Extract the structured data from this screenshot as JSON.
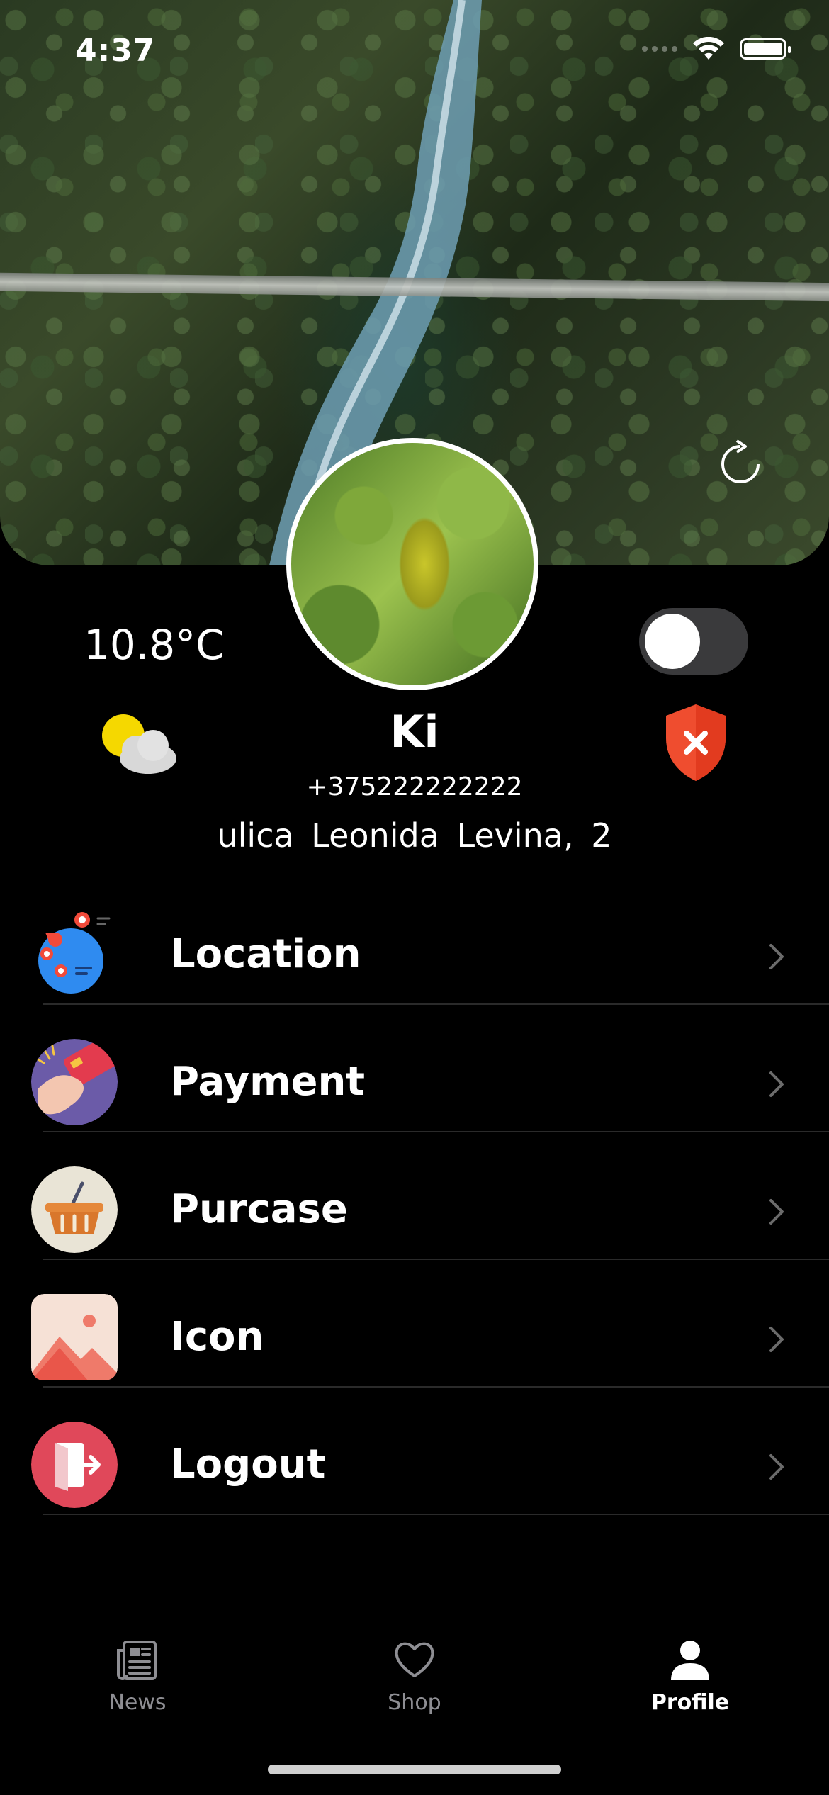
{
  "status_bar": {
    "time": "4:37"
  },
  "profile": {
    "temperature": "10.8°C",
    "name": "Ki",
    "phone": "+375222222222",
    "address": "ulica  Leonida  Levina,  2",
    "toggle_on": false
  },
  "menu": {
    "items": [
      {
        "label": "Location",
        "icon": "location-map-icon"
      },
      {
        "label": "Payment",
        "icon": "payment-card-icon"
      },
      {
        "label": "Purcase",
        "icon": "basket-icon"
      },
      {
        "label": "Icon",
        "icon": "image-icon"
      },
      {
        "label": "Logout",
        "icon": "logout-door-icon"
      }
    ]
  },
  "tabbar": {
    "tabs": [
      {
        "label": "News",
        "icon": "newspaper-icon",
        "active": false
      },
      {
        "label": "Shop",
        "icon": "heart-icon",
        "active": false
      },
      {
        "label": "Profile",
        "icon": "person-icon",
        "active": true
      }
    ]
  },
  "colors": {
    "background": "#000000",
    "accent": "#ffffff",
    "inactive_tab": "#8e8e93",
    "shield": "#ef4d2f",
    "logout": "#e0485a"
  }
}
